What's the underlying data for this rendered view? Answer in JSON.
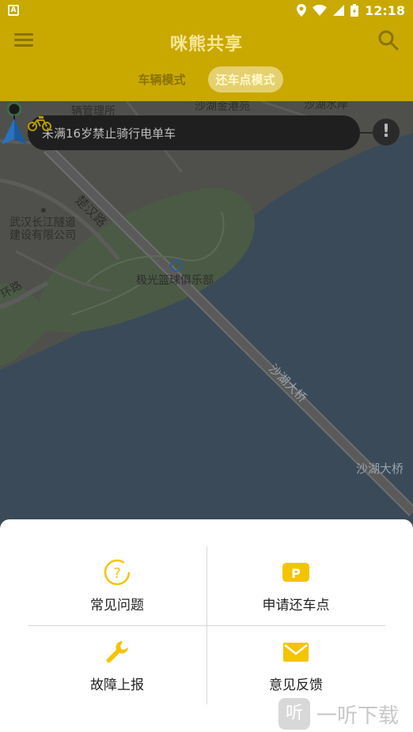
{
  "status_bar": {
    "time": "12:18"
  },
  "header": {
    "title": "咪熊共享",
    "tabs": [
      {
        "label": "车辆模式",
        "active": false
      },
      {
        "label": "还车点模式",
        "active": true
      }
    ]
  },
  "notice": {
    "text": "未满16岁禁止骑行电单车",
    "alert_symbol": "!"
  },
  "map_labels": {
    "road1": "楚汉路",
    "tunnel": "武汉长江隧道建设有限公司",
    "club": "极光篮球俱乐部",
    "bridge_road": "沙湖大桥",
    "bridge_corner": "沙湖大桥",
    "top1": "辆管理所",
    "top2": "沙湖金港苑",
    "top3": "沙湖水岸",
    "ring": "环路"
  },
  "menu": {
    "items": [
      {
        "label": "常见问题",
        "icon": "question-icon"
      },
      {
        "label": "申请还车点",
        "icon": "parking-icon"
      },
      {
        "label": "故障上报",
        "icon": "wrench-icon"
      },
      {
        "label": "意见反馈",
        "icon": "mail-icon"
      }
    ]
  },
  "watermark": {
    "glyph": "听",
    "text": "一听下载"
  },
  "colors": {
    "accent": "#ffd700",
    "header_dim": "#c9a800"
  }
}
